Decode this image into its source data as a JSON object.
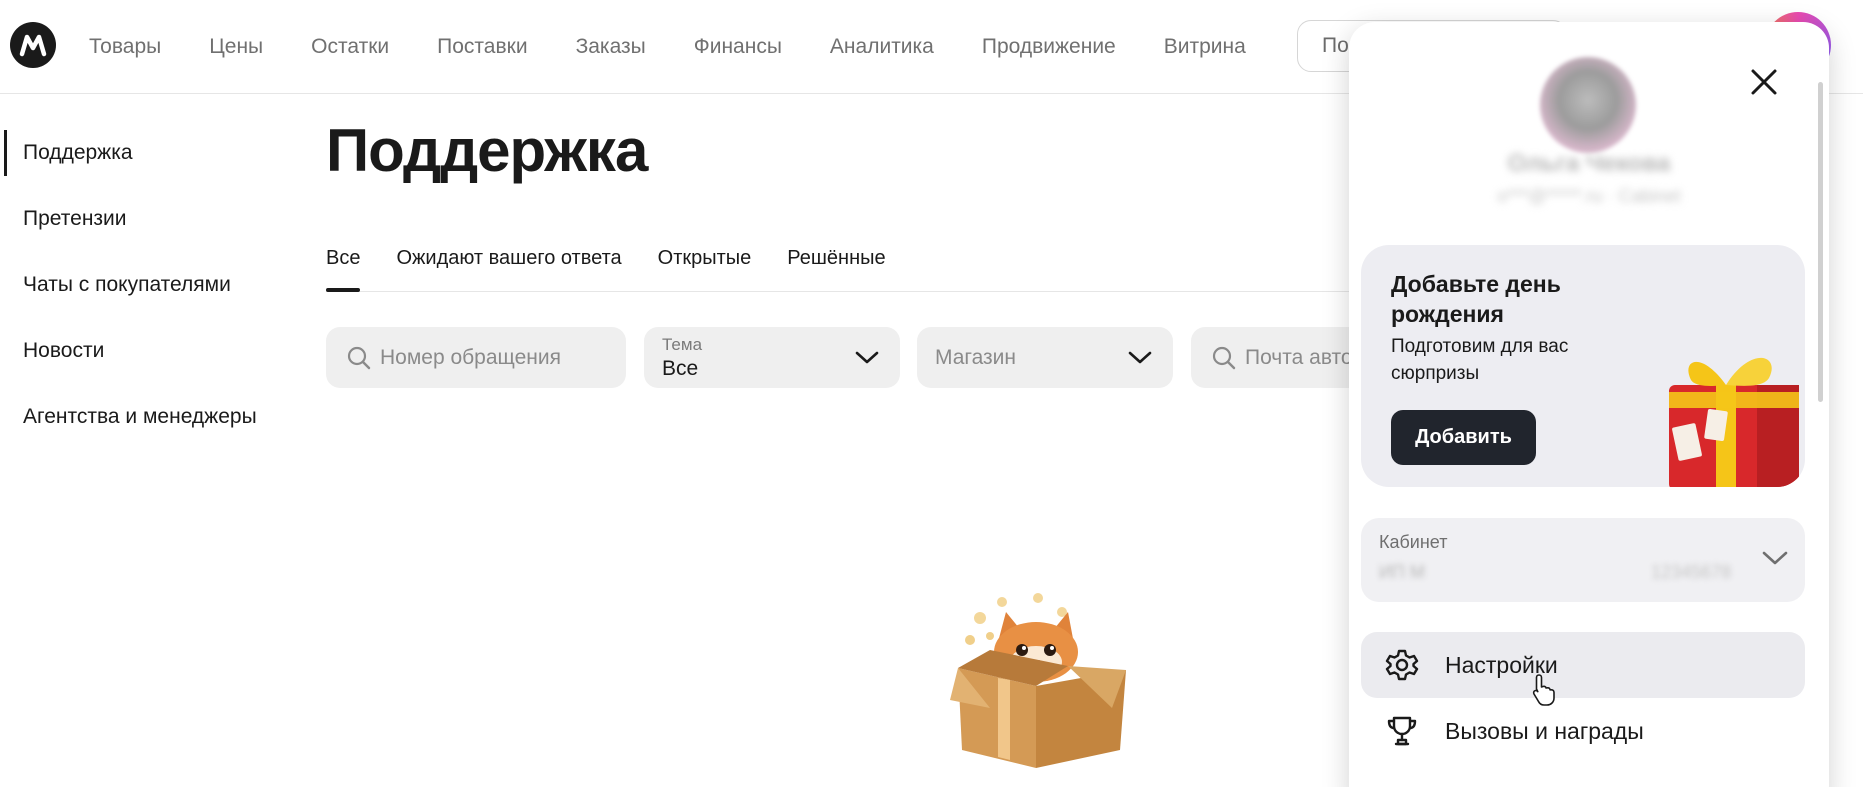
{
  "nav": {
    "items": [
      "Товары",
      "Цены",
      "Остатки",
      "Поставки",
      "Заказы",
      "Финансы",
      "Аналитика",
      "Продвижение",
      "Витрина"
    ],
    "search_text": "Поиск"
  },
  "sidebar": {
    "items": [
      {
        "label": "Поддержка",
        "active": true
      },
      {
        "label": "Претензии"
      },
      {
        "label": "Чаты с покупателями"
      },
      {
        "label": "Новости"
      },
      {
        "label": "Агентства и менеджеры"
      }
    ]
  },
  "main": {
    "title": "Поддержка",
    "tabs": [
      "Все",
      "Ожидают вашего ответа",
      "Открытые",
      "Решённые"
    ],
    "filters": {
      "request_number_placeholder": "Номер обращения",
      "topic_label": "Тема",
      "topic_value": "Все",
      "store_placeholder": "Магазин",
      "email_placeholder": "Почта автора"
    }
  },
  "popup": {
    "user_name": "Ольга Чекова",
    "user_login": "o***@*****.ru · Cabinet",
    "promo": {
      "title": "Добавьте день рождения",
      "subtitle": "Подготовим для вас сюрпризы",
      "button": "Добавить"
    },
    "cabinet": {
      "label": "Кабинет",
      "value": "ИП М",
      "id": "12345678"
    },
    "menu": [
      "Настройки",
      "Вызовы и награды"
    ]
  },
  "colors": {
    "primary_dark": "#21252d",
    "field_bg": "#efefef",
    "promo_bg": "#ededf2",
    "gift_red": "#d8282b",
    "gift_ribbon": "#f5c518"
  },
  "icons": {
    "logo": "market-logo",
    "search": "search-icon",
    "chevron": "chevron-down-icon",
    "close": "close-icon",
    "settings": "gear-icon",
    "rewards": "trophy-icon"
  }
}
